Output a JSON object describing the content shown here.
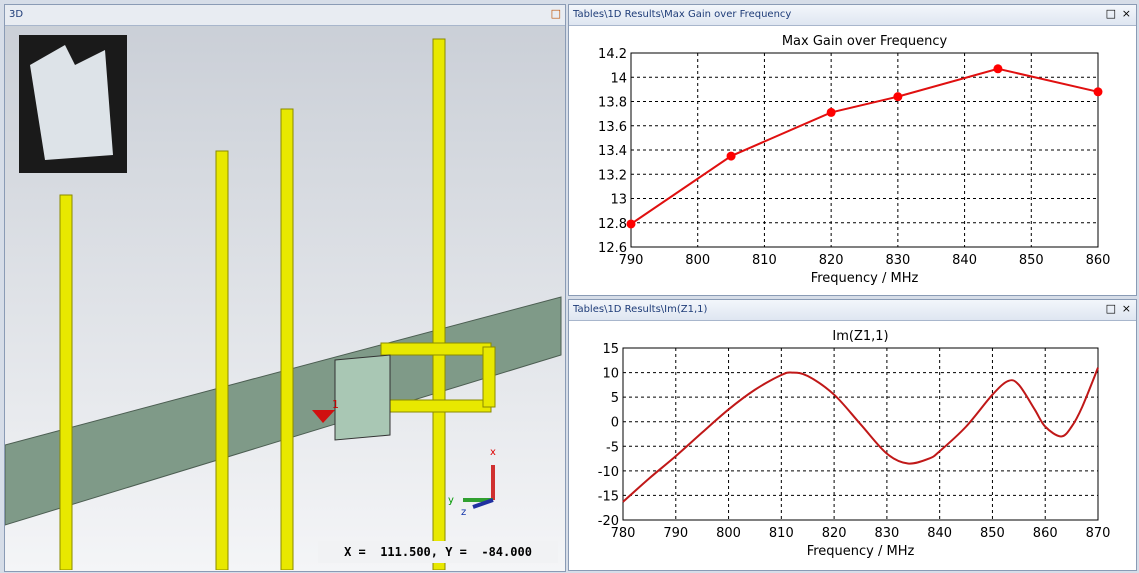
{
  "left_panel": {
    "title": "3D",
    "readout": "X =  111.500, Y =  -84.000",
    "axes": {
      "x": "x",
      "y": "y",
      "z": "z"
    },
    "port_label": "1"
  },
  "top_panel": {
    "title": "Tables\\1D Results\\Max Gain over Frequency"
  },
  "bottom_panel": {
    "title": "Tables\\1D Results\\Im(Z1,1)"
  },
  "controls": {
    "maximize": "□",
    "close": "×"
  },
  "chart_data": [
    {
      "type": "line",
      "title": "Max Gain over Frequency",
      "xlabel": "Frequency / MHz",
      "ylabel": "",
      "xlim": [
        790,
        860
      ],
      "ylim": [
        12.6,
        14.2
      ],
      "xticks": [
        "790",
        "800",
        "810",
        "820",
        "830",
        "840",
        "850",
        "860"
      ],
      "yticks": [
        "12.6",
        "12.8",
        "13",
        "13.2",
        "13.4",
        "13.6",
        "13.8",
        "14",
        "14.2"
      ],
      "grid": true,
      "markers": true,
      "color": "#e01010",
      "x": [
        790,
        805,
        820,
        830,
        845,
        860
      ],
      "y": [
        12.79,
        13.35,
        13.71,
        13.84,
        14.07,
        13.88
      ]
    },
    {
      "type": "line",
      "title": "Im(Z1,1)",
      "xlabel": "Frequency / MHz",
      "ylabel": "",
      "xlim": [
        780,
        870
      ],
      "ylim": [
        -20,
        15
      ],
      "xticks": [
        "780",
        "790",
        "800",
        "810",
        "820",
        "830",
        "840",
        "850",
        "860",
        "870"
      ],
      "yticks": [
        "-20",
        "-15",
        "-10",
        "-5",
        "0",
        "5",
        "10",
        "15"
      ],
      "grid": true,
      "markers": false,
      "color": "#c01818",
      "x": [
        780,
        785,
        790,
        795,
        800,
        805,
        810,
        812,
        815,
        820,
        825,
        830,
        834,
        838,
        840,
        845,
        850,
        853,
        855,
        858,
        860,
        863,
        865,
        867,
        870
      ],
      "y": [
        -16.3,
        -11.5,
        -7,
        -2.2,
        2.5,
        6.5,
        9.5,
        10,
        9.3,
        5.5,
        -0.5,
        -6.5,
        -8.5,
        -7.5,
        -6,
        -1,
        5.5,
        8.3,
        7.5,
        2.5,
        -1,
        -3,
        -1,
        3,
        11
      ]
    }
  ]
}
